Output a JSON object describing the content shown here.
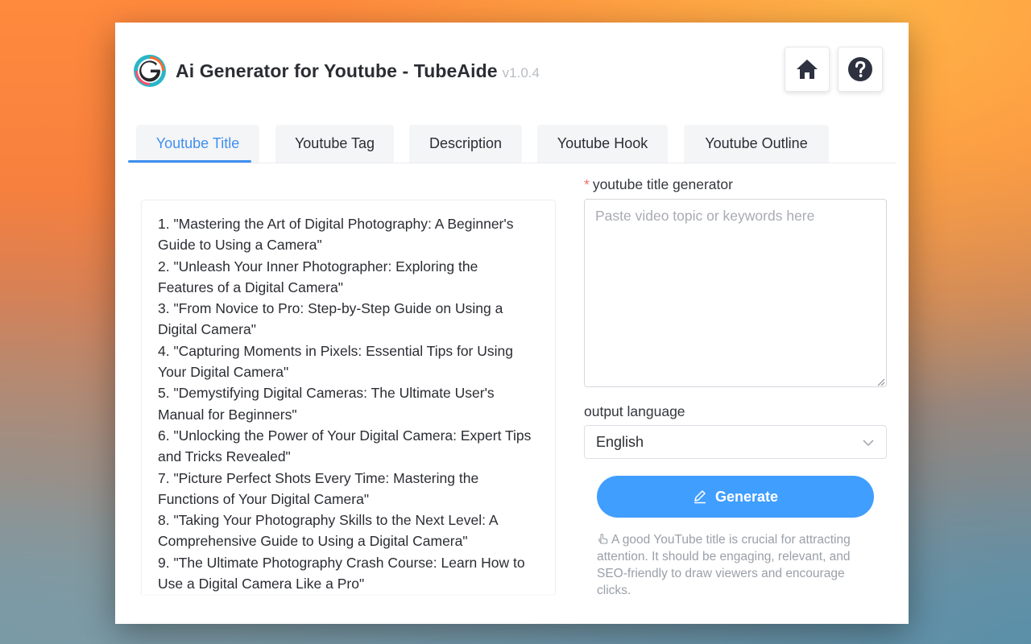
{
  "app": {
    "title": "Ai Generator for Youtube - TubeAide",
    "version": "v1.0.4",
    "home_icon": "home-icon",
    "help_icon": "question-circle-icon"
  },
  "tabs": [
    {
      "label": "Youtube Title",
      "active": true
    },
    {
      "label": "Youtube Tag",
      "active": false
    },
    {
      "label": "Description",
      "active": false
    },
    {
      "label": "Youtube Hook",
      "active": false
    },
    {
      "label": "Youtube Outline",
      "active": false
    }
  ],
  "output": {
    "lines": [
      "1. \"Mastering the Art of Digital Photography: A Beginner's",
      "Guide to Using a Camera\"",
      "2. \"Unleash Your Inner Photographer: Exploring the",
      "Features of a Digital Camera\"",
      "3. \"From Novice to Pro: Step-by-Step Guide on Using a",
      "Digital Camera\"",
      "4. \"Capturing Moments in Pixels: Essential Tips for Using",
      "Your Digital Camera\"",
      "5. \"Demystifying Digital Cameras: The Ultimate User's",
      "Manual for Beginners\"",
      "6. \"Unlocking the Power of Your Digital Camera: Expert Tips",
      "and Tricks Revealed\"",
      "7. \"Picture Perfect Shots Every Time: Mastering the",
      "Functions of Your Digital Camera\"",
      "8. \"Taking Your Photography Skills to the Next Level: A",
      "Comprehensive Guide to Using a Digital Camera\"",
      "9. \"The Ultimate Photography Crash Course: Learn How to",
      "Use a Digital Camera Like a Pro\""
    ]
  },
  "form": {
    "required_mark": "*",
    "topic_label": "youtube title generator",
    "topic_placeholder": "Paste video topic or keywords here",
    "topic_value": "",
    "language_label": "output language",
    "language_value": "English",
    "generate_label": "Generate",
    "tip": "A good YouTube title is crucial for attracting attention. It should be engaging, relevant, and SEO-friendly to draw viewers and encourage clicks."
  },
  "colors": {
    "accent": "#409eff",
    "active_tab": "#3f8ff0",
    "required": "#f56c6c"
  }
}
